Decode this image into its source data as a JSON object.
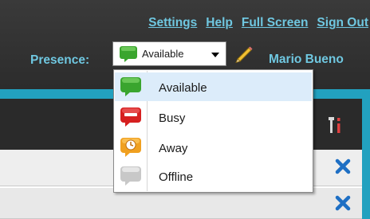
{
  "header": {
    "links": [
      "Settings",
      "Help",
      "Full Screen",
      "Sign Out"
    ],
    "presence_label": "Presence:",
    "user_name": "Mario Bueno"
  },
  "presence": {
    "selected": "Available",
    "options": [
      {
        "label": "Available",
        "icon": "available-status-icon",
        "color": "#3aa52e"
      },
      {
        "label": "Busy",
        "icon": "busy-status-icon",
        "color": "#d62020"
      },
      {
        "label": "Away",
        "icon": "away-status-icon",
        "color": "#f0a020"
      },
      {
        "label": "Offline",
        "icon": "offline-status-icon",
        "color": "#c8c8c8"
      }
    ]
  },
  "colors": {
    "link": "#6fc7e0",
    "accent_strip": "#22a1bf",
    "header_bg": "#2c2c2c",
    "close_icon": "#1e6fc4",
    "selected_item_bg": "#dcecfa"
  }
}
